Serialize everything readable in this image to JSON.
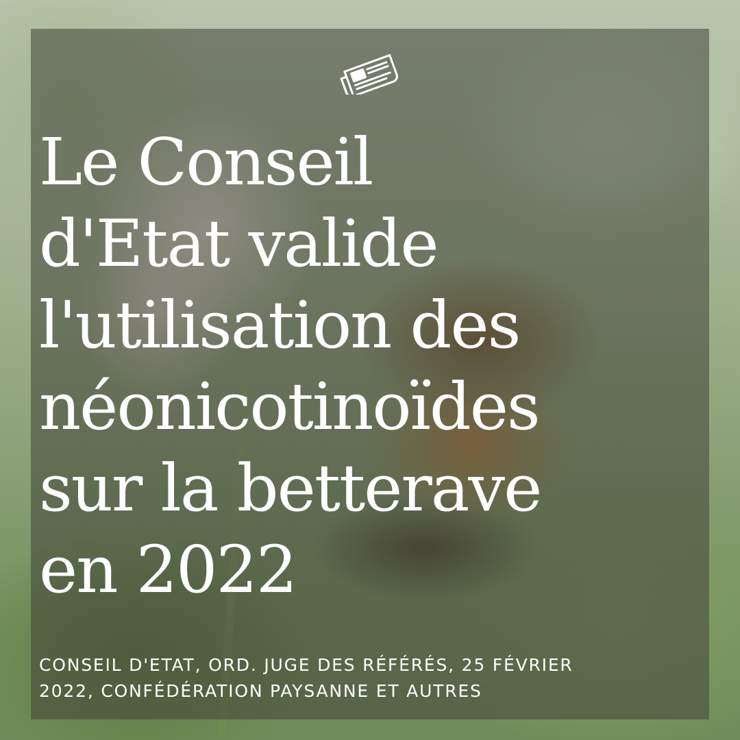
{
  "background": {
    "image": "bee-on-clover-photo",
    "overlay_color": "#424438"
  },
  "icon": {
    "name": "newspaper-icon"
  },
  "headline": {
    "lines": [
      "Le Conseil",
      "d'Etat valide",
      "l'utilisation des",
      "néonicotinoïdes",
      "sur la betterave",
      "en 2022"
    ]
  },
  "citation": {
    "lines": [
      "CONSEIL D'ETAT, ORD. JUGE DES RÉFÉRÉS, 25 FÉVRIER",
      "2022, CONFÉDÉRATION PAYSANNE ET AUTRES"
    ]
  }
}
